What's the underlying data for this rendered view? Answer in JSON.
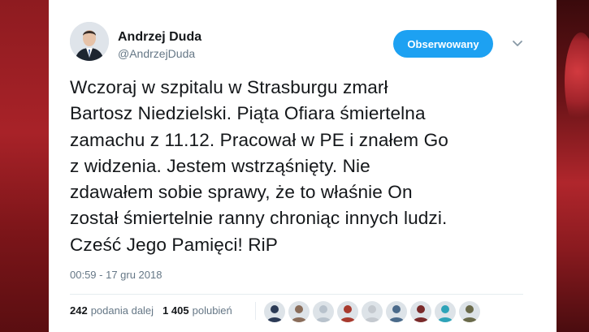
{
  "tweet": {
    "author_name": "Andrzej Duda",
    "author_handle": "@AndrzejDuda",
    "follow_label": "Obserwowany",
    "text": "Wczoraj w szpitalu w Strasburgu zmarł\nBartosz Niedzielski. Piąta Ofiara śmiertelna\nzamachu z 11.12. Pracował w PE i znałem Go\nz widzenia. Jestem wstrząśnięty. Nie\nzdawałem sobie sprawy, że to właśnie On\nzostał śmiertelnie ranny chroniąc innych ludzi.\nCześć Jego Pamięci! RiP",
    "timestamp": "00:59 - 17 gru 2018"
  },
  "stats": {
    "retweets_count": "242",
    "retweets_label": "podania dalej",
    "likes_count": "1 405",
    "likes_label": "polubień"
  },
  "likers": [
    {
      "avatar_color": "#2b3a55"
    },
    {
      "avatar_color": "#8a6d5a"
    },
    {
      "avatar_color": "#b8c2cc"
    },
    {
      "avatar_color": "#a83a2e"
    },
    {
      "avatar_color": "#c4c9cf"
    },
    {
      "avatar_color": "#4a6a8a"
    },
    {
      "avatar_color": "#7a2a2a"
    },
    {
      "avatar_color": "#2ea3b8"
    },
    {
      "avatar_color": "#6a6a4a"
    }
  ],
  "colors": {
    "accent": "#1da1f2",
    "text": "#14171a",
    "muted": "#657786"
  }
}
